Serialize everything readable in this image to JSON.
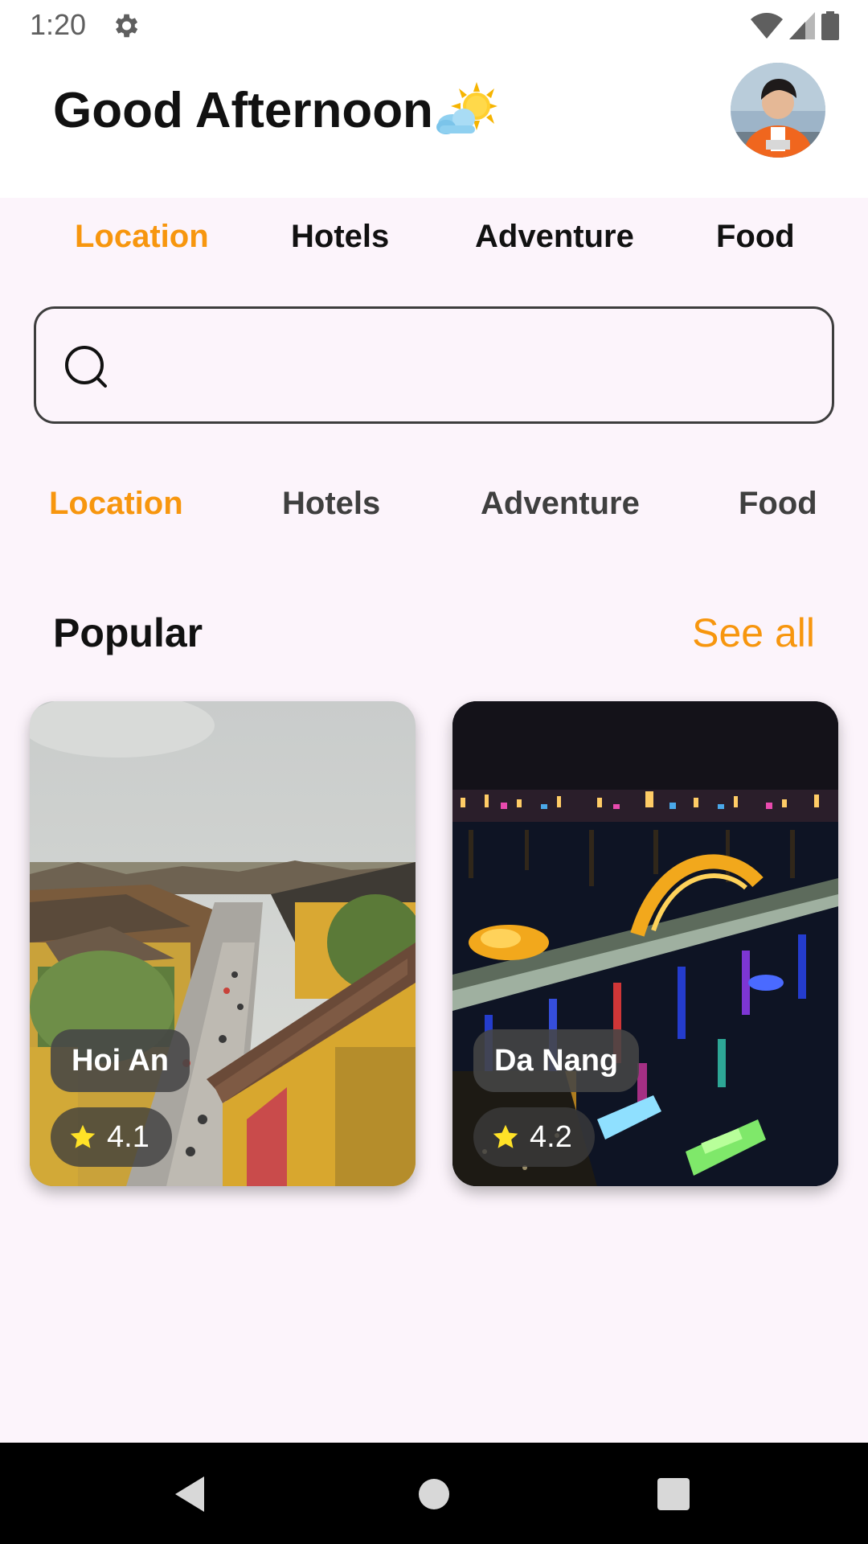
{
  "status_bar": {
    "time": "1:20"
  },
  "header": {
    "greeting": "Good Afternoon"
  },
  "top_tabs": [
    "Location",
    "Hotels",
    "Adventure",
    "Food"
  ],
  "search": {
    "placeholder": ""
  },
  "sub_tabs": [
    "Location",
    "Hotels",
    "Adventure",
    "Food"
  ],
  "popular": {
    "title": "Popular",
    "see_all": "See all"
  },
  "places": [
    {
      "name": "Hoi An",
      "rating": "4.1"
    },
    {
      "name": "Da Nang",
      "rating": "4.2"
    }
  ],
  "colors": {
    "accent": "#F7960E",
    "background": "#FCF4FB",
    "star": "#FFE227"
  }
}
